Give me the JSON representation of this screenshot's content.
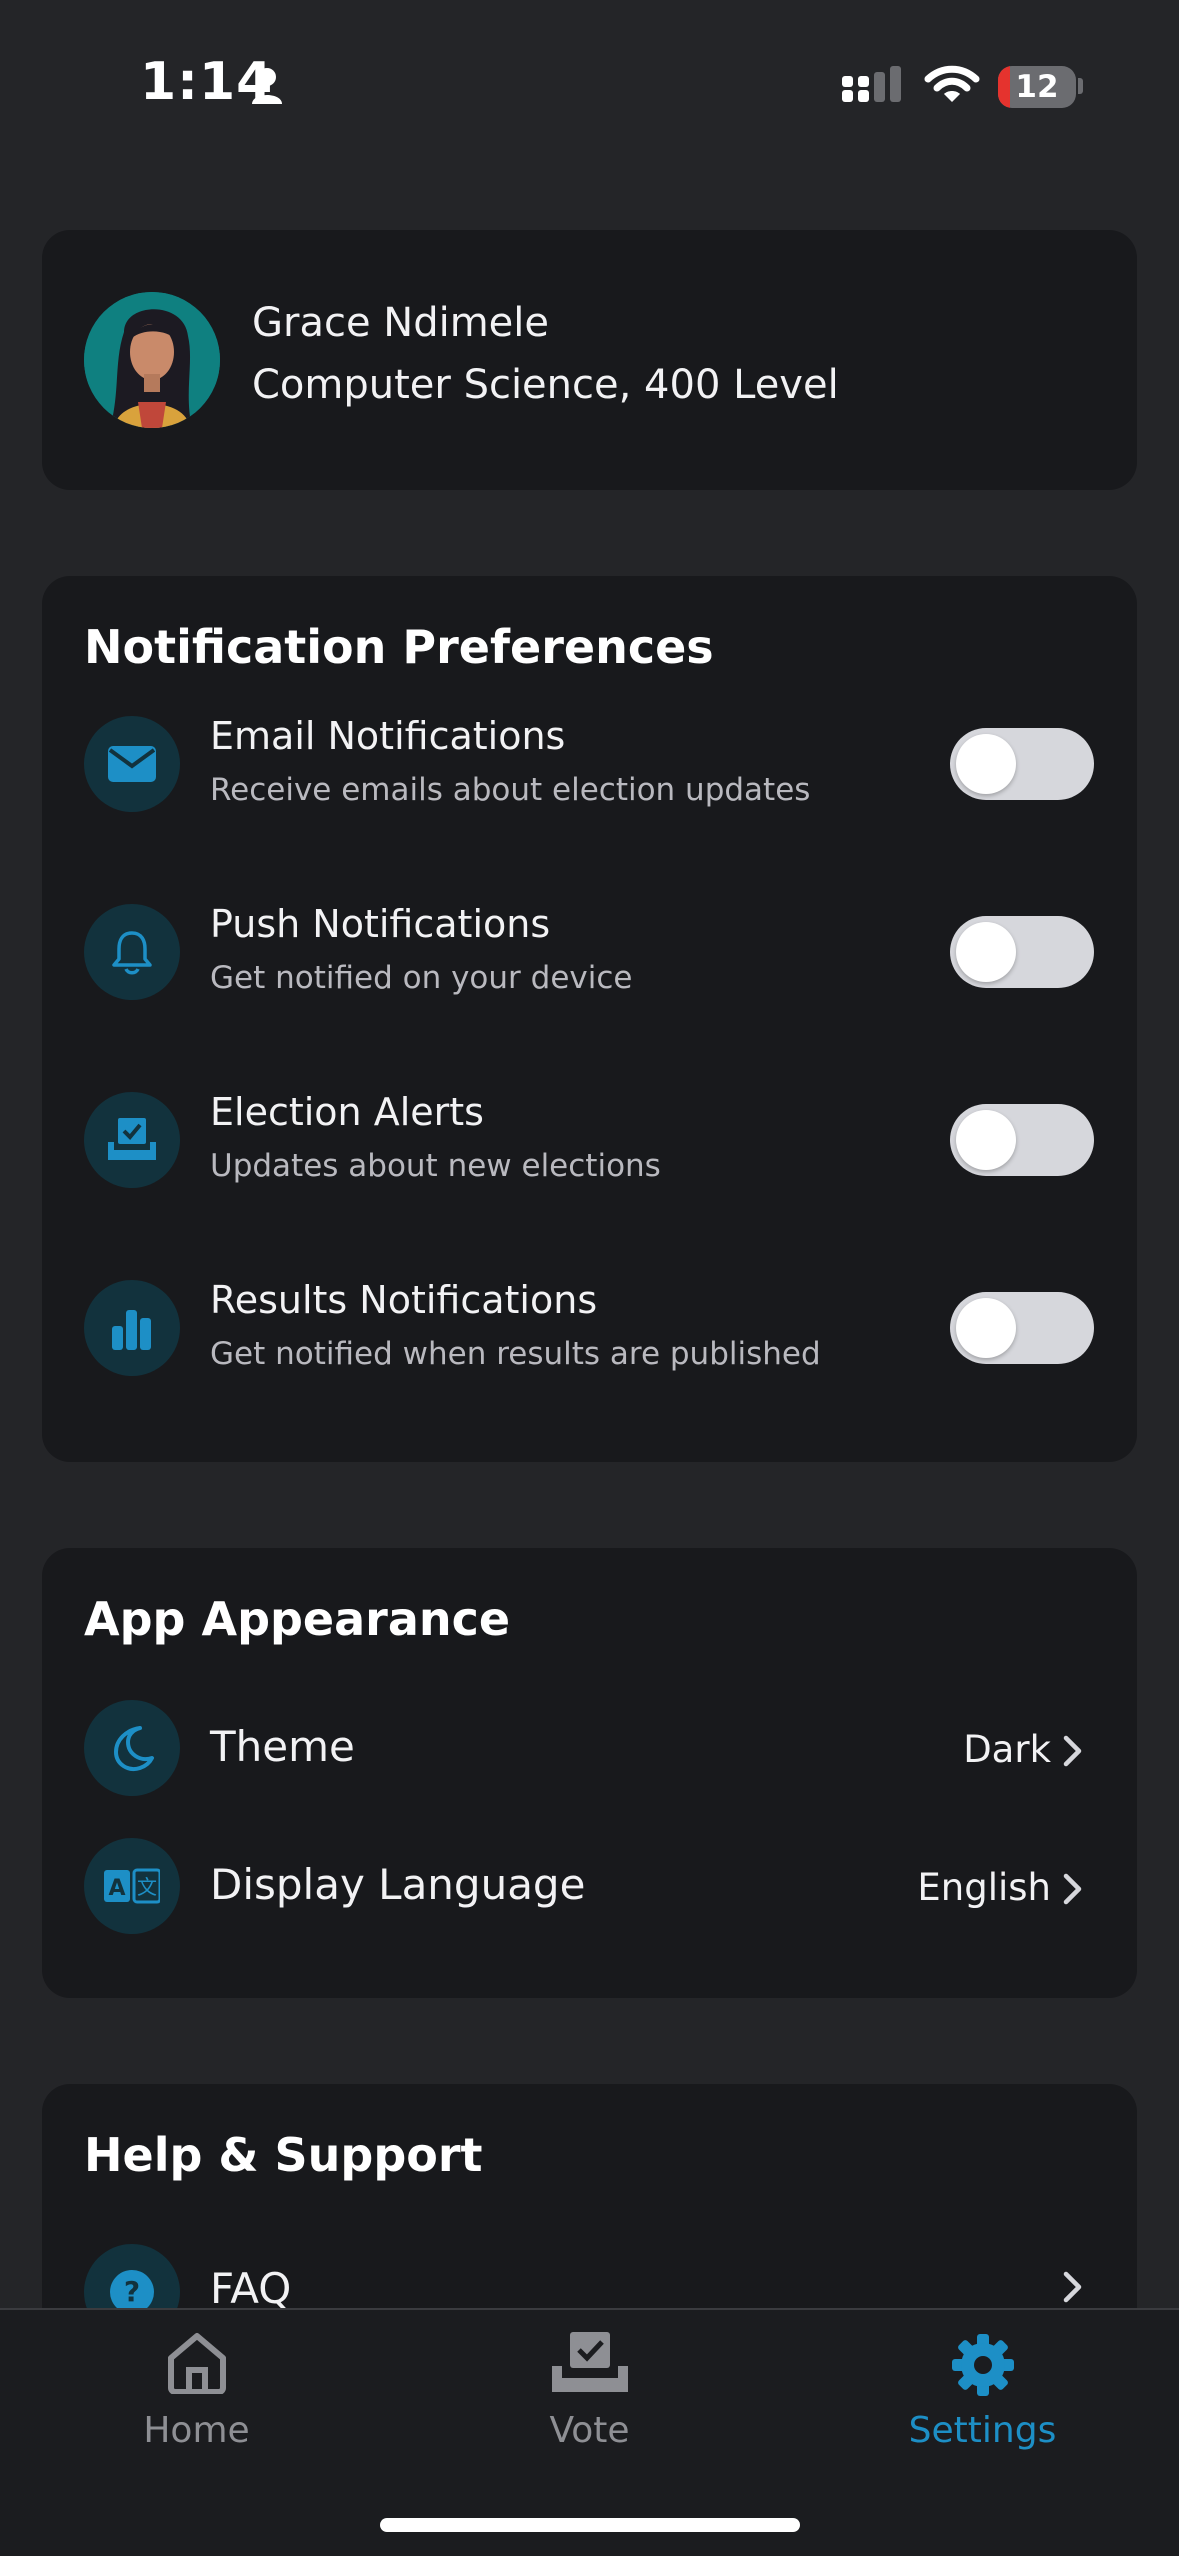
{
  "status_bar": {
    "time": "1:14",
    "battery_level": "12",
    "icons": [
      "person-icon",
      "signal-icon",
      "wifi-icon",
      "battery-icon"
    ]
  },
  "profile": {
    "name": "Grace Ndimele",
    "department": "Computer Science, 400 Level"
  },
  "notification_preferences": {
    "title": "Notification Preferences",
    "items": [
      {
        "icon": "envelope-icon",
        "title": "Email Notifications",
        "subtitle": "Receive emails about election updates",
        "enabled": false
      },
      {
        "icon": "bell-icon",
        "title": "Push Notifications",
        "subtitle": "Get notified on your device",
        "enabled": false
      },
      {
        "icon": "ballot-box-icon",
        "title": "Election Alerts",
        "subtitle": "Updates about new elections",
        "enabled": false
      },
      {
        "icon": "bar-chart-icon",
        "title": "Results Notifications",
        "subtitle": "Get notified when results are published",
        "enabled": false
      }
    ]
  },
  "app_appearance": {
    "title": "App Appearance",
    "items": [
      {
        "icon": "moon-icon",
        "label": "Theme",
        "value": "Dark"
      },
      {
        "icon": "translate-icon",
        "label": "Display Language",
        "value": "English"
      }
    ]
  },
  "help_support": {
    "title": "Help & Support",
    "items": [
      {
        "icon": "question-icon",
        "label": "FAQ"
      }
    ]
  },
  "tab_bar": {
    "tabs": [
      {
        "icon": "home-icon",
        "label": "Home",
        "active": false
      },
      {
        "icon": "vote-icon",
        "label": "Vote",
        "active": false
      },
      {
        "icon": "gear-icon",
        "label": "Settings",
        "active": true
      }
    ]
  },
  "colors": {
    "background": "#242528",
    "card": "#18191c",
    "accent": "#1d8fc6",
    "icon_circle": "#12323d",
    "toggle_off": "#d6d7dc"
  }
}
